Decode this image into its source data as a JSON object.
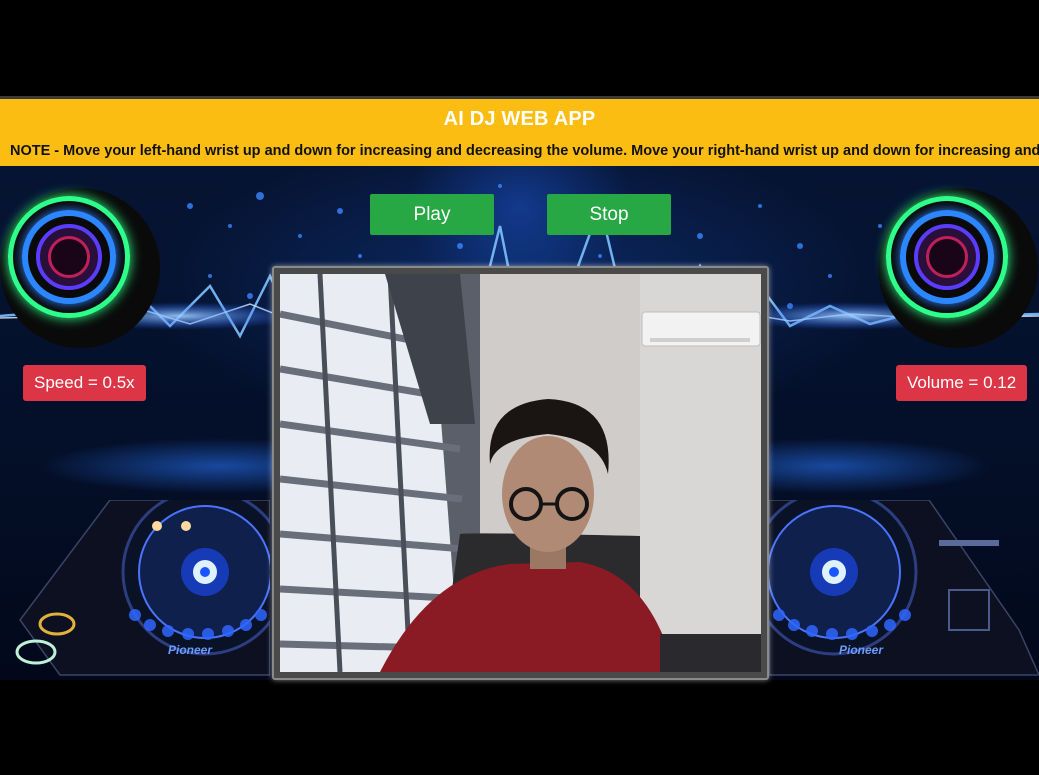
{
  "app": {
    "title": "AI DJ WEB APP",
    "note": "NOTE - Move your left-hand wrist up and down for increasing and decreasing the volume. Move your right-hand wrist up and down for increasing and decreasing the speed."
  },
  "controls": {
    "play_label": "Play",
    "stop_label": "Stop"
  },
  "status": {
    "speed_text": "Speed = 0.5x",
    "speed_value": 0.5,
    "volume_text": "Volume = 0.12",
    "volume_value": 0.12
  },
  "deck": {
    "brand": "Pioneer"
  },
  "colors": {
    "banner": "#fcbd12",
    "button": "#28a745",
    "badge": "#dc3545"
  },
  "icons": [
    "speaker-left-icon",
    "speaker-right-icon",
    "turntable-left-icon",
    "turntable-right-icon"
  ]
}
